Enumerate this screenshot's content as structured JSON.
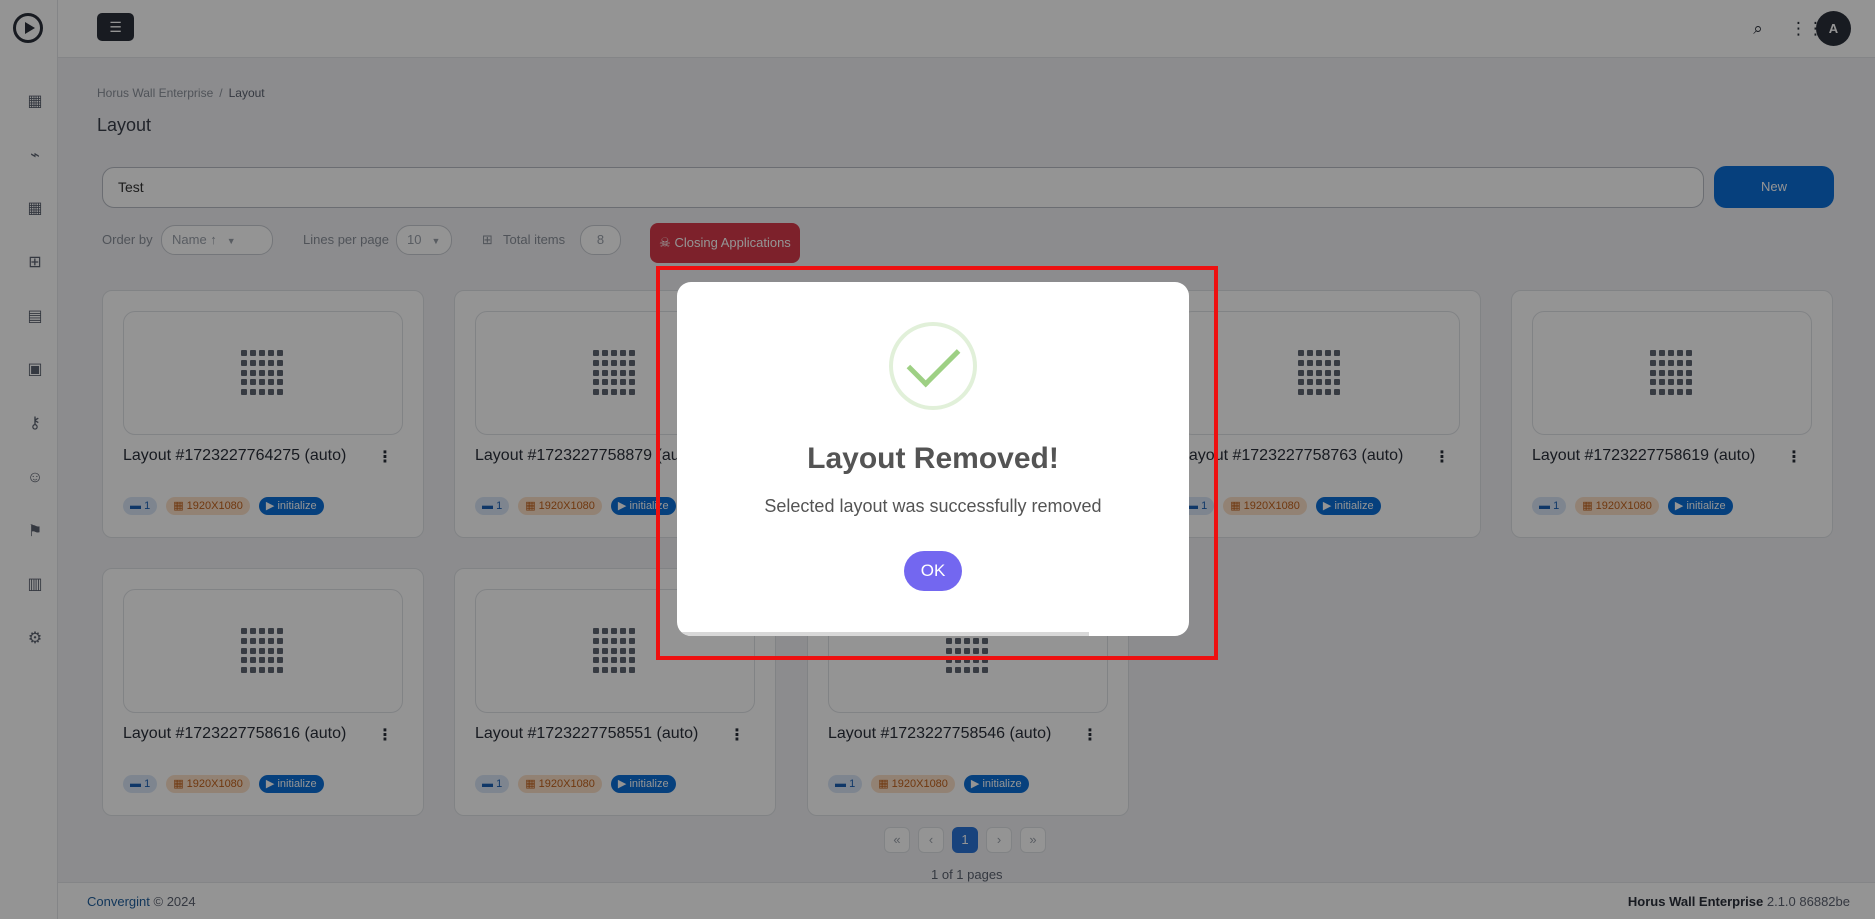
{
  "topbar": {
    "avatar_initial": "A"
  },
  "breadcrumb": {
    "root": "Horus Wall Enterprise",
    "separator": "/",
    "current": "Layout"
  },
  "page_title": "Layout",
  "search": {
    "value": "Test"
  },
  "new_button": "New",
  "filters": {
    "order_by_label": "Order by",
    "order_by_value": "Name ↑",
    "lines_per_page_label": "Lines per page",
    "lines_per_page_value": "10",
    "total_items_label": "Total items",
    "total_items_value": "8",
    "closing_apps": "Closing Applications"
  },
  "cards": [
    {
      "title": "Layout #1723227764275 (auto)",
      "count": "1",
      "resolution": "1920X1080",
      "action": "initialize"
    },
    {
      "title": "Layout #1723227758879 (auto)",
      "count": "1",
      "resolution": "1920X1080",
      "action": "initialize"
    },
    {
      "title": "Layout #1723227758763 (auto)",
      "count": "1",
      "resolution": "1920X1080",
      "action": "initialize"
    },
    {
      "title": "Layout #1723227758619 (auto)",
      "count": "1",
      "resolution": "1920X1080",
      "action": "initialize"
    },
    {
      "title": "Layout #1723227758616 (auto)",
      "count": "1",
      "resolution": "1920X1080",
      "action": "initialize"
    },
    {
      "title": "Layout #1723227758551 (auto)",
      "count": "1",
      "resolution": "1920X1080",
      "action": "initialize"
    },
    {
      "title": "Layout #1723227758546 (auto)",
      "count": "1",
      "resolution": "1920X1080",
      "action": "initialize"
    }
  ],
  "pagination": {
    "first": "«",
    "prev": "‹",
    "current": "1",
    "next": "›",
    "last": "»",
    "info": "1 of 1 pages"
  },
  "footer": {
    "brand": "Convergint",
    "copyright": "© 2024",
    "product": "Horus Wall Enterprise",
    "version": "2.1.0 86882be"
  },
  "modal": {
    "title": "Layout Removed!",
    "text": "Selected layout was successfully removed",
    "ok": "OK"
  },
  "colors": {
    "primary": "#0b6fd8",
    "danger": "#d83a4b",
    "modal_button": "#7367f0",
    "success": "#9ed084",
    "highlight": "#ee1010"
  }
}
